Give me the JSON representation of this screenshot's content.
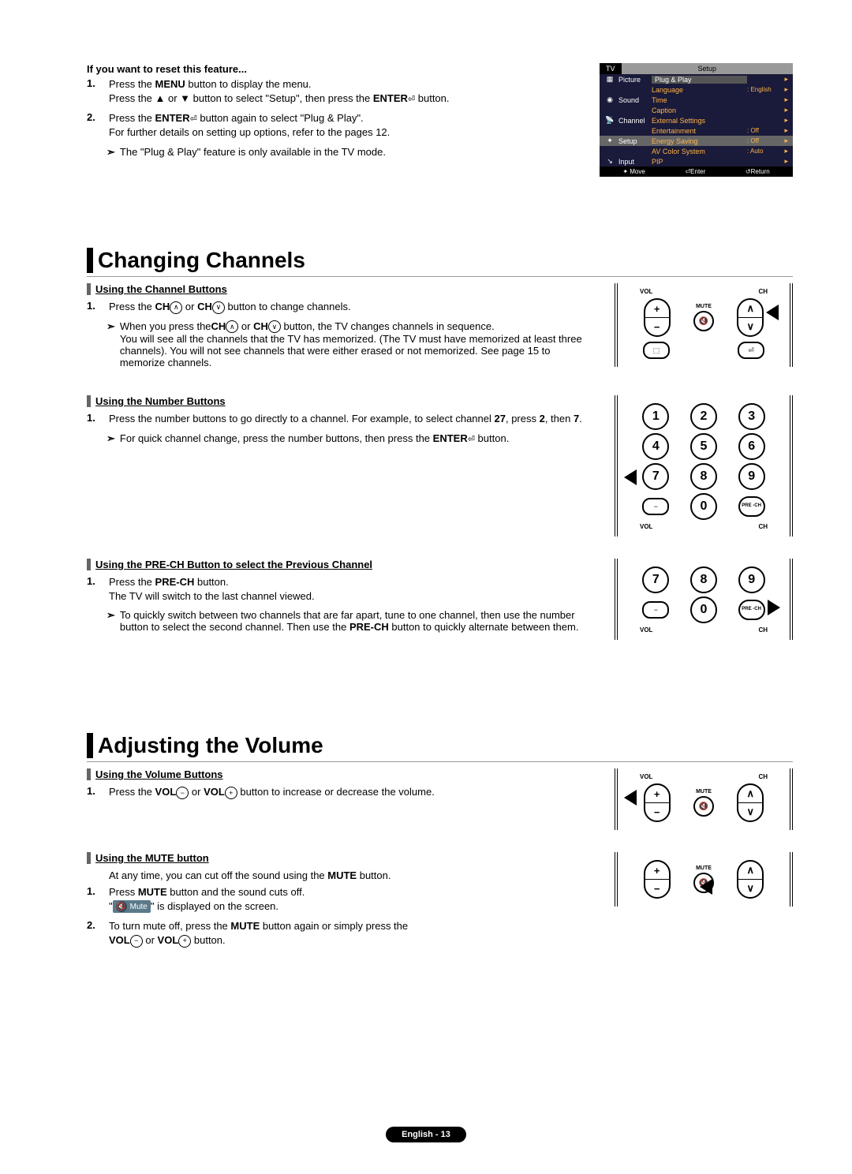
{
  "reset": {
    "heading": "If you want to reset this feature...",
    "step1_pre": "Press the ",
    "step1_btn": "MENU",
    "step1_post": " button to display the menu.",
    "step1_line2a": "Press the ▲ or ▼ button to select \"Setup\", then press the ",
    "step1_line2b": "ENTER",
    "step1_line2c": " button.",
    "step2_pre": "Press the ",
    "step2_btn": "ENTER",
    "step2_post": " button again to select \"Plug & Play\".",
    "step2_line2": "For further details on setting up options, refer to the pages 12.",
    "note": "The \"Plug & Play\" feature is only available in the TV mode."
  },
  "tv_menu": {
    "title_left": "TV",
    "title_right": "Setup",
    "sidebar": [
      "Picture",
      "Sound",
      "Channel",
      "Setup",
      "Input"
    ],
    "items": [
      {
        "name": "Plug & Play",
        "val": ""
      },
      {
        "name": "Language",
        "val": ": English"
      },
      {
        "name": "Time",
        "val": ""
      },
      {
        "name": "Caption",
        "val": ""
      },
      {
        "name": "External Settings",
        "val": ""
      },
      {
        "name": "Entertainment",
        "val": ": Off"
      },
      {
        "name": "Energy Saving",
        "val": ": Off"
      },
      {
        "name": "AV Color System",
        "val": ": Auto"
      },
      {
        "name": "PIP",
        "val": ""
      }
    ],
    "footer_move": "Move",
    "footer_enter": "Enter",
    "footer_return": "Return"
  },
  "changing": {
    "title": "Changing Channels",
    "sub1": {
      "heading": "Using the Channel Buttons",
      "step_pre": "Press the ",
      "step_mid1": "CH",
      "step_mid2": " or ",
      "step_mid3": "CH",
      "step_post": " button to change channels.",
      "note_pre": "When you press the",
      "note_mid1": "CH",
      "note_mid2": " or ",
      "note_mid3": "CH",
      "note_post": " button, the TV changes channels in sequence.",
      "note_extra": "You will see all the channels that the TV has memorized. (The TV must have memorized at least three channels). You will not see channels that were either erased or not memorized. See page 15 to memorize channels."
    },
    "sub2": {
      "heading": "Using the Number Buttons",
      "step": "Press the number buttons to go directly to a channel. For example, to select channel ",
      "step_ch": "27",
      "step_mid": ", press ",
      "step_b1": "2",
      "step_mid2": ", then ",
      "step_b2": "7",
      "step_end": ".",
      "note_pre": "For quick channel change, press the number buttons, then press the ",
      "note_btn": "ENTER",
      "note_post": " button."
    },
    "sub3": {
      "heading": "Using the PRE-CH Button to select the Previous Channel",
      "step_pre": "Press the ",
      "step_btn": "PRE-CH",
      "step_post": " button.",
      "step_line2": "The TV will switch to the last channel viewed.",
      "note_pre": "To quickly switch between two channels that are far apart, tune to one channel, then use the number button to select the second channel. Then use the ",
      "note_btn": "PRE-CH",
      "note_post": " button to quickly alternate between them."
    }
  },
  "adjusting": {
    "title": "Adjusting the Volume",
    "sub1": {
      "heading": "Using the Volume Buttons",
      "step_pre": "Press the ",
      "step_b1": "VOL",
      "step_mid": " or ",
      "step_b2": "VOL",
      "step_post": " button to increase or decrease the volume."
    },
    "sub2": {
      "heading": "Using the MUTE button",
      "intro_pre": "At any time, you can cut off the sound using the ",
      "intro_btn": "MUTE",
      "intro_post": " button.",
      "s1_pre": "Press ",
      "s1_btn": "MUTE",
      "s1_post": " button and the sound cuts off.",
      "s1_line2_pre": "\"",
      "s1_disp": "Mute",
      "s1_line2_post": "\" is displayed on the screen.",
      "s2_pre": "To turn mute off, press the ",
      "s2_btn": "MUTE",
      "s2_mid": " button again or simply press the ",
      "s2_vol1": "VOL",
      "s2_or": " or ",
      "s2_vol2": "VOL",
      "s2_post": " button."
    }
  },
  "remote_labels": {
    "vol": "VOL",
    "ch": "CH",
    "mute": "MUTE",
    "pre": "PRE\n-CH"
  },
  "footer": "English - 13"
}
